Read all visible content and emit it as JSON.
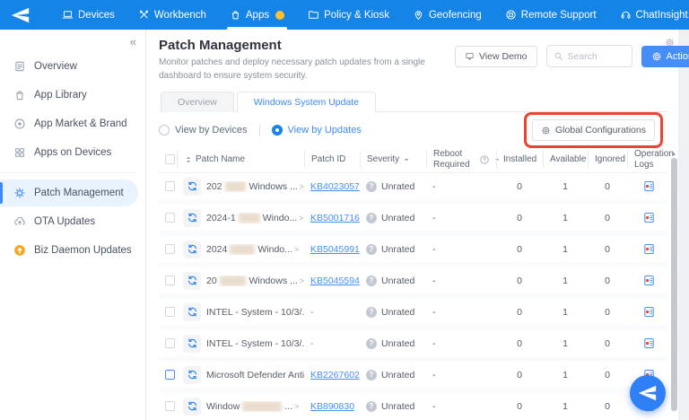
{
  "navbar": {
    "brand_icon": "paper-plane",
    "items": [
      {
        "id": "devices",
        "label": "Devices",
        "icon": "laptop",
        "active": false,
        "badge": false
      },
      {
        "id": "workbench",
        "label": "Workbench",
        "icon": "tools",
        "active": false,
        "badge": false
      },
      {
        "id": "apps",
        "label": "Apps",
        "icon": "bag",
        "active": true,
        "badge": true
      },
      {
        "id": "policy-kiosk",
        "label": "Policy & Kiosk",
        "icon": "folder",
        "active": false,
        "badge": false
      },
      {
        "id": "geofencing",
        "label": "Geofencing",
        "icon": "location",
        "active": false,
        "badge": false
      },
      {
        "id": "remote-support",
        "label": "Remote Support",
        "icon": "lifebuoy",
        "active": false,
        "badge": false
      },
      {
        "id": "chatinsight",
        "label": "ChatInsight.AI",
        "icon": "headset",
        "active": false,
        "badge": false
      }
    ]
  },
  "sidebar": {
    "collapse_glyph": "«",
    "items": [
      {
        "id": "overview",
        "label": "Overview",
        "icon": "doc",
        "active": false,
        "divider_before": false
      },
      {
        "id": "app-library",
        "label": "App Library",
        "icon": "bag",
        "active": false,
        "divider_before": false
      },
      {
        "id": "app-market-brand",
        "label": "App Market & Brand",
        "icon": "circle-dot",
        "active": false,
        "divider_before": false
      },
      {
        "id": "apps-on-devices",
        "label": "Apps on Devices",
        "icon": "grid",
        "active": false,
        "divider_before": false
      },
      {
        "id": "patch-management",
        "label": "Patch Management",
        "icon": "patch",
        "active": true,
        "divider_before": true
      },
      {
        "id": "ota-updates",
        "label": "OTA Updates",
        "icon": "cloud-up",
        "active": false,
        "divider_before": false
      },
      {
        "id": "biz-daemon-updates",
        "label": "Biz Daemon Updates",
        "icon": "alert-up",
        "active": false,
        "divider_before": false
      }
    ]
  },
  "header": {
    "title": "Patch Management",
    "subtitle": "Monitor patches and deploy necessary patch updates from a single dashboard to ensure system security.",
    "view_demo_label": "View Demo",
    "search_placeholder": "Search",
    "actions_label": "Actions"
  },
  "tabs": {
    "overview": "Overview",
    "windows_system_update": "Windows System Update"
  },
  "toolbar": {
    "view_by_devices": "View by Devices",
    "view_by_updates": "View by Updates",
    "global_config_label": "Global Configurations"
  },
  "table": {
    "columns": {
      "patch_name": "Patch Name",
      "patch_id": "Patch ID",
      "severity": "Severity",
      "reboot": "Reboot Required",
      "installed": "Installed",
      "available": "Available",
      "ignored": "Ignored",
      "operation_logs": "Operation Logs"
    },
    "chevron": ">",
    "rows": [
      {
        "name_prefix": "202",
        "redact": 34,
        "name_suffix": "Windows ...",
        "patch_id": "KB4023057",
        "link": true,
        "severity": "Unrated",
        "reboot": "-",
        "installed": "0",
        "available": "1",
        "ignored": "0",
        "checkbox_highlight": false
      },
      {
        "name_prefix": "2024-1",
        "redact": 24,
        "name_suffix": "Windo...",
        "patch_id": "KB5001716",
        "link": true,
        "severity": "Unrated",
        "reboot": "-",
        "installed": "0",
        "available": "1",
        "ignored": "0",
        "checkbox_highlight": false
      },
      {
        "name_prefix": "2024",
        "redact": 28,
        "name_suffix": "Windo...",
        "patch_id": "KB5045991",
        "link": true,
        "severity": "Unrated",
        "reboot": "-",
        "installed": "0",
        "available": "1",
        "ignored": "0",
        "checkbox_highlight": false
      },
      {
        "name_prefix": "20",
        "redact": 34,
        "name_suffix": "Windows ...",
        "patch_id": "KB5045594",
        "link": true,
        "severity": "Unrated",
        "reboot": "-",
        "installed": "0",
        "available": "1",
        "ignored": "0",
        "checkbox_highlight": false
      },
      {
        "name_prefix": "INTEL - System - 10/3/...",
        "redact": 0,
        "name_suffix": "",
        "patch_id": "-",
        "link": false,
        "severity": "Unrated",
        "reboot": "-",
        "installed": "0",
        "available": "1",
        "ignored": "0",
        "checkbox_highlight": false
      },
      {
        "name_prefix": "INTEL - System - 10/3/...",
        "redact": 0,
        "name_suffix": "",
        "patch_id": "-",
        "link": false,
        "severity": "Unrated",
        "reboot": "-",
        "installed": "0",
        "available": "1",
        "ignored": "0",
        "checkbox_highlight": false
      },
      {
        "name_prefix": "Microsoft Defender Anti...",
        "redact": 0,
        "name_suffix": "",
        "patch_id": "KB2267602",
        "link": true,
        "severity": "Unrated",
        "reboot": "-",
        "installed": "0",
        "available": "1",
        "ignored": "0",
        "checkbox_highlight": true
      },
      {
        "name_prefix": "Window",
        "redact": 44,
        "name_suffix": "...",
        "patch_id": "KB890830",
        "link": true,
        "severity": "Unrated",
        "reboot": "-",
        "installed": "0",
        "available": "1",
        "ignored": "0",
        "checkbox_highlight": false
      }
    ]
  },
  "colors": {
    "navbar_blue": "#1485e6",
    "accent_blue": "#3d8af7",
    "actions_button_blue": "#458df7",
    "annotation_red": "#e8462e",
    "badge_yellow": "#fdc02f",
    "biz_daemon_orange": "#f5a623",
    "link_blue": "#4491f8"
  }
}
